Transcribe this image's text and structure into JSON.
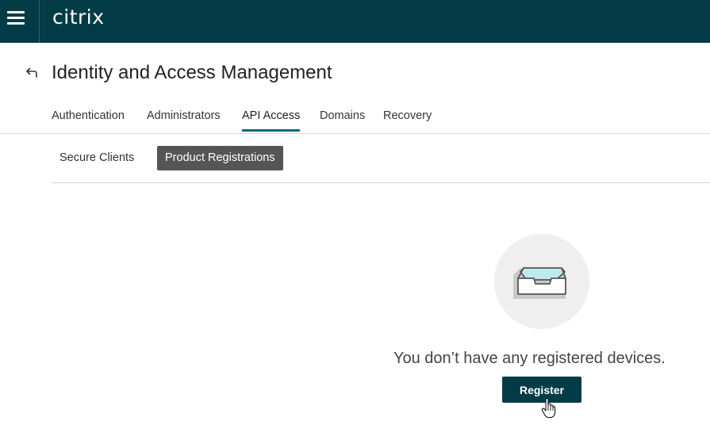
{
  "header": {
    "logo_text": "citrix",
    "menu_icon": "hamburger-menu-icon",
    "background_color": "#033c46"
  },
  "page": {
    "back_icon": "back-arrow-icon",
    "title": "Identity and Access Management"
  },
  "tabs": [
    {
      "label": "Authentication",
      "active": false
    },
    {
      "label": "Administrators",
      "active": false
    },
    {
      "label": "API Access",
      "active": true
    },
    {
      "label": "Domains",
      "active": false
    },
    {
      "label": "Recovery",
      "active": false
    }
  ],
  "subtabs": [
    {
      "label": "Secure Clients",
      "active": false
    },
    {
      "label": "Product Registrations",
      "active": true
    }
  ],
  "empty_state": {
    "icon": "empty-inbox-icon",
    "message": "You don’t have any registered devices.",
    "button_label": "Register",
    "button_color": "#033c46"
  },
  "accent_color": "#026d80"
}
